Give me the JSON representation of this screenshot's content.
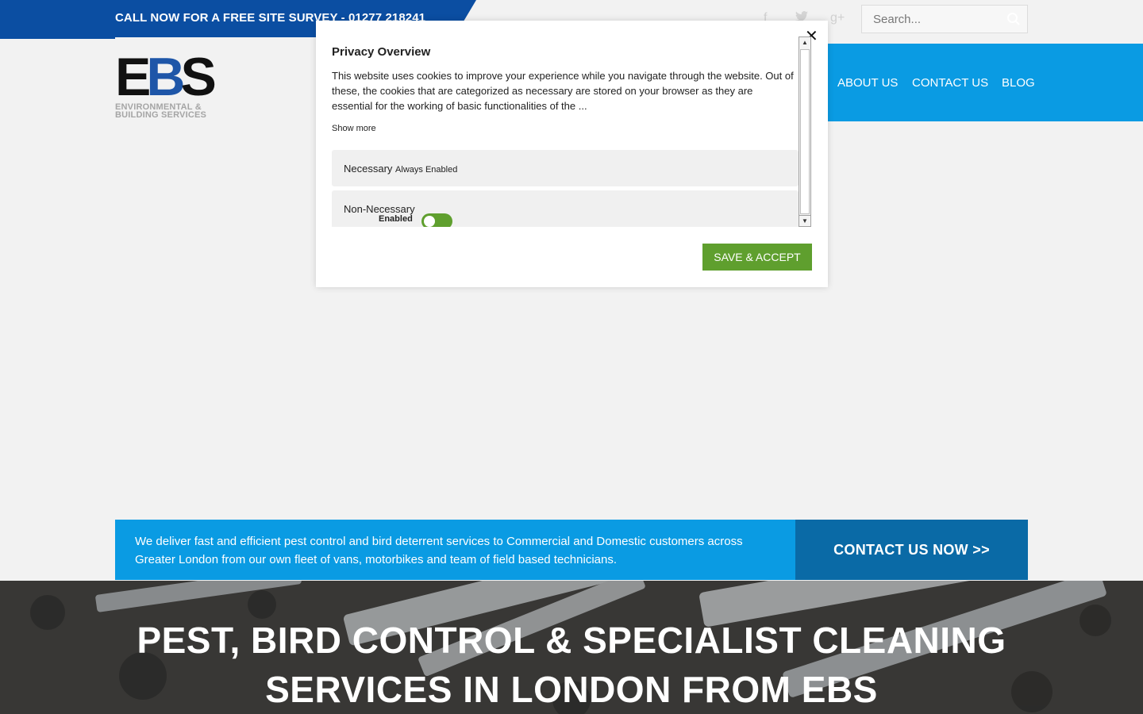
{
  "topbar": {
    "call_text": "CALL NOW FOR A FREE SITE SURVEY - 01277 218241",
    "social_icons": [
      "facebook-icon",
      "twitter-icon",
      "google-plus-icon"
    ],
    "search_placeholder": "Search..."
  },
  "logo": {
    "letter_e": "E",
    "letter_b": "B",
    "letter_s": "S",
    "sub_line1": "ENVIRONMENTAL &",
    "sub_line2": "BUILDING SERVICES"
  },
  "nav": {
    "items": [
      {
        "label": "ABOUT US"
      },
      {
        "label": "CONTACT US"
      },
      {
        "label": "BLOG"
      }
    ]
  },
  "modal": {
    "title": "Privacy Overview",
    "description": "This website uses cookies to improve your experience while you navigate through the website. Out of these, the cookies that are categorized as necessary are stored on your browser as they are essential for the working of basic functionalities of the ...",
    "show_more": "Show more",
    "categories": [
      {
        "name": "Necessary",
        "status": "Always Enabled"
      },
      {
        "name": "Non-Necessary",
        "status": "Enabled",
        "toggle_on": true
      }
    ],
    "save_button": "SAVE & ACCEPT",
    "close_icon": "close-icon"
  },
  "info": {
    "text": "We deliver fast and efficient pest control and bird deterrent services to Commercial and Domestic customers across Greater London from our own fleet of vans, motorbikes and team of field based technicians.",
    "cta": "CONTACT US NOW >>"
  },
  "hero": {
    "title_line1": "PEST, BIRD CONTROL & SPECIALIST CLEANING",
    "title_line2": "SERVICES IN LONDON FROM EBS"
  },
  "colors": {
    "brand_blue": "#0b4ea2",
    "nav_blue": "#0a9be3",
    "cta_blue": "#0a6aa6",
    "accept_green": "#5f9f2e"
  }
}
